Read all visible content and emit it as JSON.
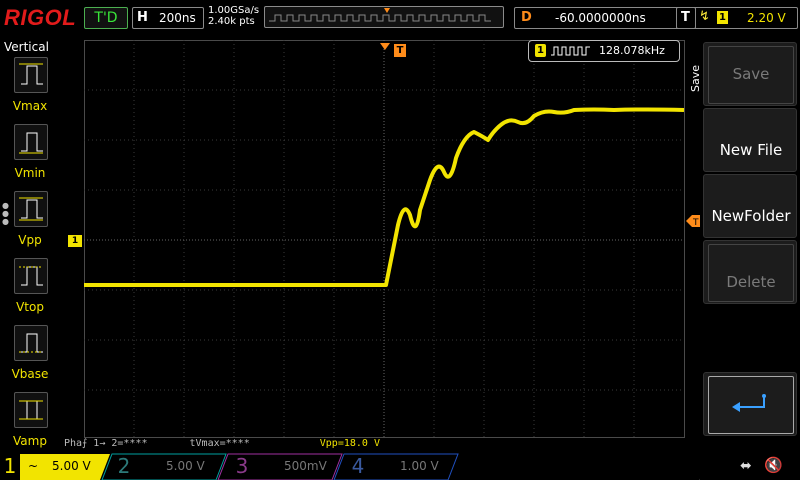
{
  "header": {
    "brand": "RIGOL",
    "run_state": "T'D",
    "horizontal": {
      "key": "H",
      "value": "200ns"
    },
    "sample_rate": "1.00GSa/s",
    "memory_points": "2.40k pts",
    "delay": {
      "key": "D",
      "value": "-60.0000000ns"
    },
    "trigger": {
      "key": "T",
      "edge": "rising",
      "channel": "1",
      "level": "2.20 V"
    }
  },
  "left_menu": {
    "title": "Vertical",
    "items": [
      {
        "label": "Vmax"
      },
      {
        "label": "Vmin"
      },
      {
        "label": "Vpp"
      },
      {
        "label": "Vtop"
      },
      {
        "label": "Vbase"
      },
      {
        "label": "Vamp"
      }
    ]
  },
  "counter": {
    "channel": "1",
    "value": "128.078kHz"
  },
  "right_menu": {
    "tab_label": "Save",
    "items": [
      {
        "label": "Save",
        "enabled": false
      },
      {
        "label": "New File",
        "enabled": true
      },
      {
        "label": "NewFolder",
        "enabled": true
      },
      {
        "label": "Delete",
        "enabled": false
      },
      {
        "label": "",
        "enabled": true
      }
    ]
  },
  "measurements": {
    "phase": "Pha⨍ 1→ 2=****",
    "tvmax": "tVmax=****",
    "vpp": "Vpp=18.0 V"
  },
  "channels": [
    {
      "num": "1",
      "coupling": "~",
      "scale": "5.00 V",
      "color": "#f2e400",
      "active": true
    },
    {
      "num": "2",
      "coupling": "",
      "scale": "5.00 V",
      "color": "#00c8c8",
      "active": false
    },
    {
      "num": "3",
      "coupling": "",
      "scale": "500mV",
      "color": "#d040d0",
      "active": false
    },
    {
      "num": "4",
      "coupling": "",
      "scale": "1.00 V",
      "color": "#3070ff",
      "active": false
    }
  ],
  "marker_labels": {
    "trigger_pos": "T",
    "ch1_ground": "1"
  },
  "colors": {
    "trace": "#f2e400",
    "trigger_marker": "#ff8c1a",
    "brand": "#e21b1b"
  }
}
